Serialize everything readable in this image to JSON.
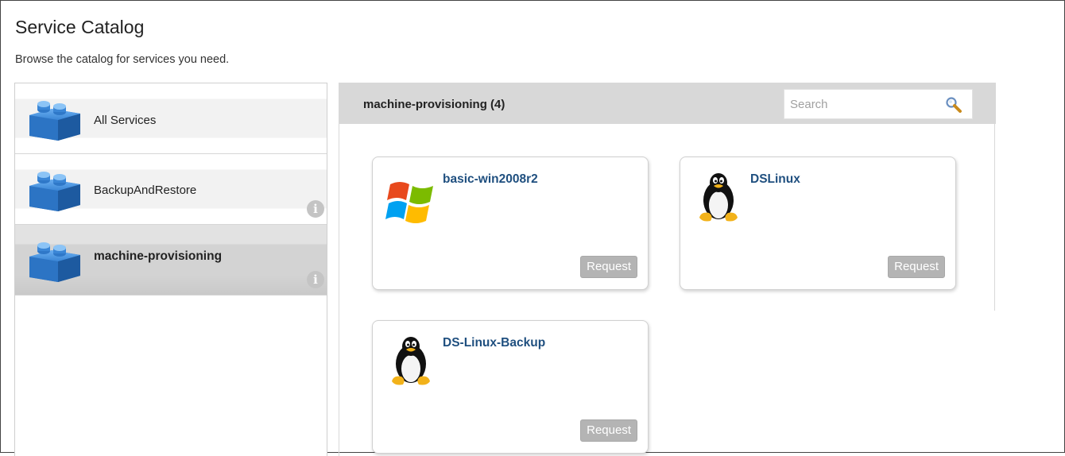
{
  "page": {
    "title": "Service Catalog",
    "subtitle": "Browse the catalog for services you need."
  },
  "sidebar": {
    "categories": [
      {
        "label": "All Services",
        "icon": "brick-icon",
        "selected": false,
        "info": false
      },
      {
        "label": "BackupAndRestore",
        "icon": "brick-icon",
        "selected": false,
        "info": true
      },
      {
        "label": "machine-provisioning",
        "icon": "brick-icon",
        "selected": true,
        "info": true
      }
    ],
    "info_glyph": "i"
  },
  "main": {
    "title": "machine-provisioning (4)",
    "search": {
      "placeholder": "Search",
      "value": "",
      "icon": "magnifier-icon"
    },
    "services": [
      {
        "name": "basic-win2008r2",
        "icon": "windows-logo-icon",
        "request_label": "Request"
      },
      {
        "name": "DSLinux",
        "icon": "tux-penguin-icon",
        "request_label": "Request"
      },
      {
        "name": "DS-Linux-Backup",
        "icon": "tux-penguin-icon",
        "request_label": "Request"
      }
    ]
  },
  "colors": {
    "brick_blue": "#2f78c8",
    "card_title": "#1f4f7f",
    "header_gray": "#d8d8d8",
    "button_gray": "#b4b4b4"
  }
}
